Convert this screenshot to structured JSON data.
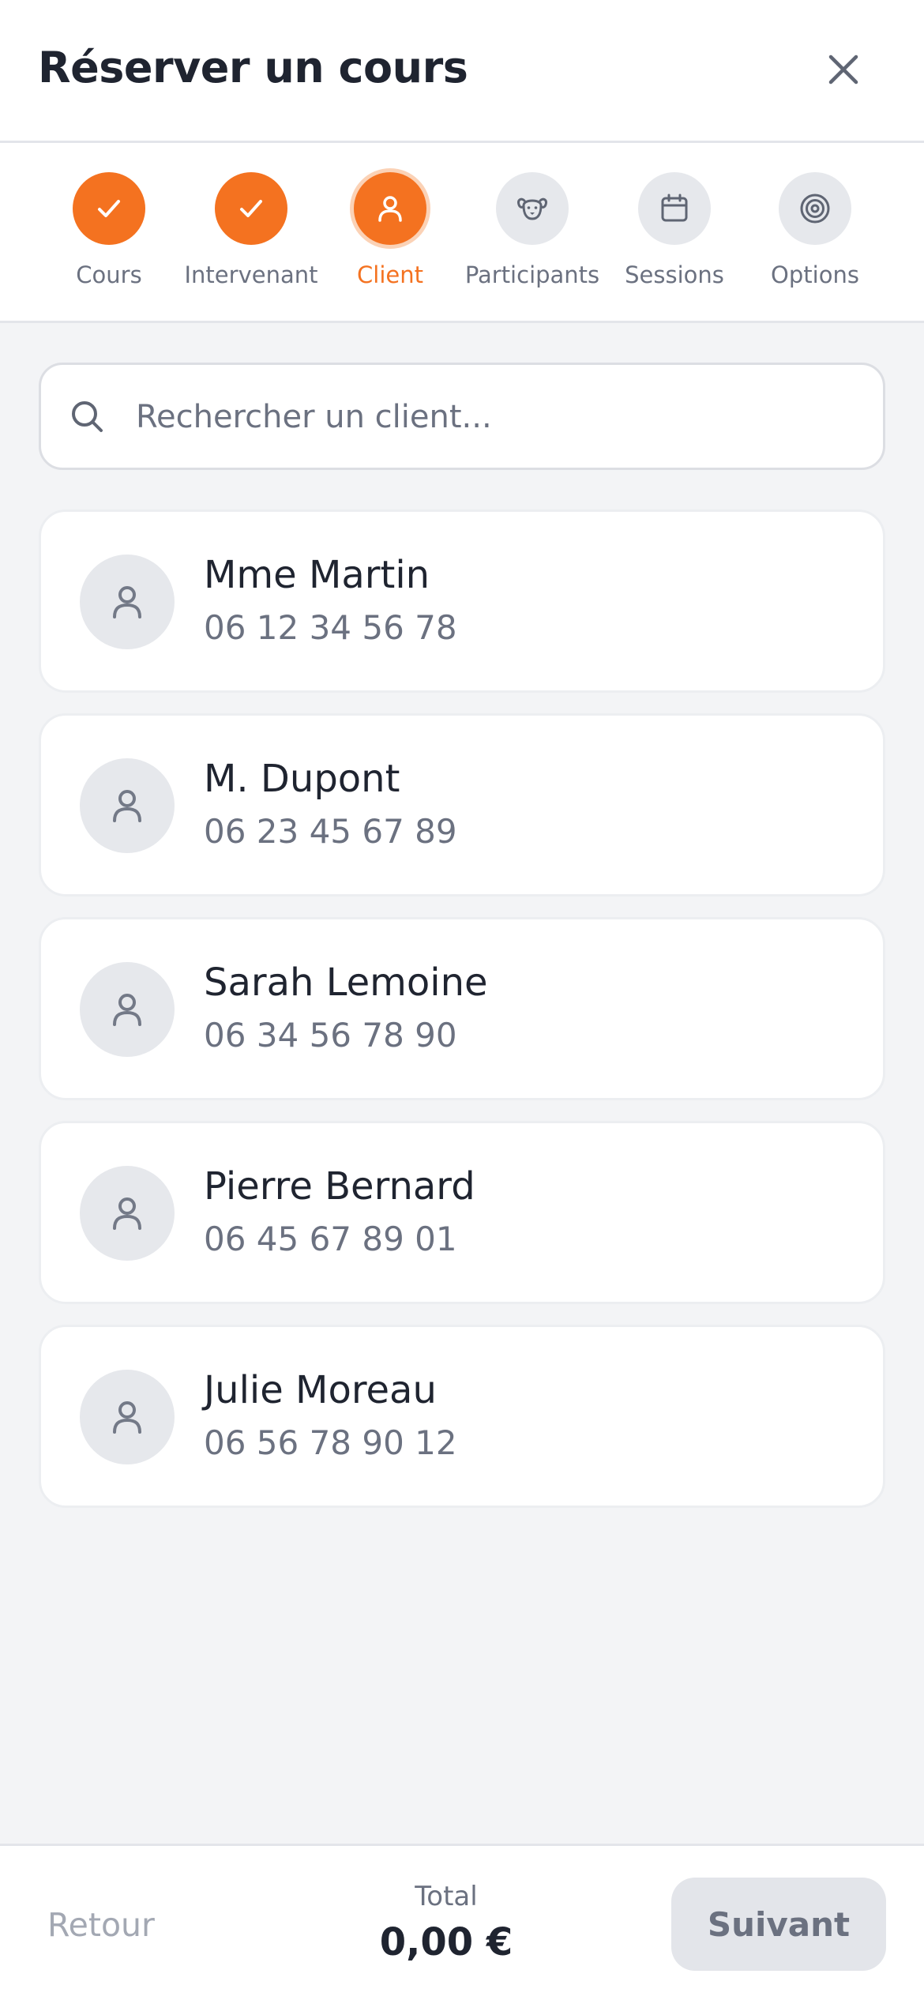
{
  "header": {
    "title": "Réserver un cours"
  },
  "stepper": {
    "accent_color": "#f47220",
    "steps": [
      {
        "label": "Cours",
        "state": "done",
        "icon": "check-icon"
      },
      {
        "label": "Intervenant",
        "state": "done",
        "icon": "check-icon"
      },
      {
        "label": "Client",
        "state": "active",
        "icon": "user-icon"
      },
      {
        "label": "Participants",
        "state": "pending",
        "icon": "pet-icon"
      },
      {
        "label": "Sessions",
        "state": "pending",
        "icon": "calendar-icon"
      },
      {
        "label": "Options",
        "state": "pending",
        "icon": "target-icon"
      }
    ]
  },
  "search": {
    "placeholder": "Rechercher un client...",
    "value": ""
  },
  "clients": [
    {
      "name": "Mme Martin",
      "phone": "06 12 34 56 78"
    },
    {
      "name": "M. Dupont",
      "phone": "06 23 45 67 89"
    },
    {
      "name": "Sarah Lemoine",
      "phone": "06 34 56 78 90"
    },
    {
      "name": "Pierre Bernard",
      "phone": "06 45 67 89 01"
    },
    {
      "name": "Julie Moreau",
      "phone": "06 56 78 90 12"
    }
  ],
  "footer": {
    "back_label": "Retour",
    "total_label": "Total",
    "total_value": "0,00 €",
    "next_label": "Suivant"
  }
}
